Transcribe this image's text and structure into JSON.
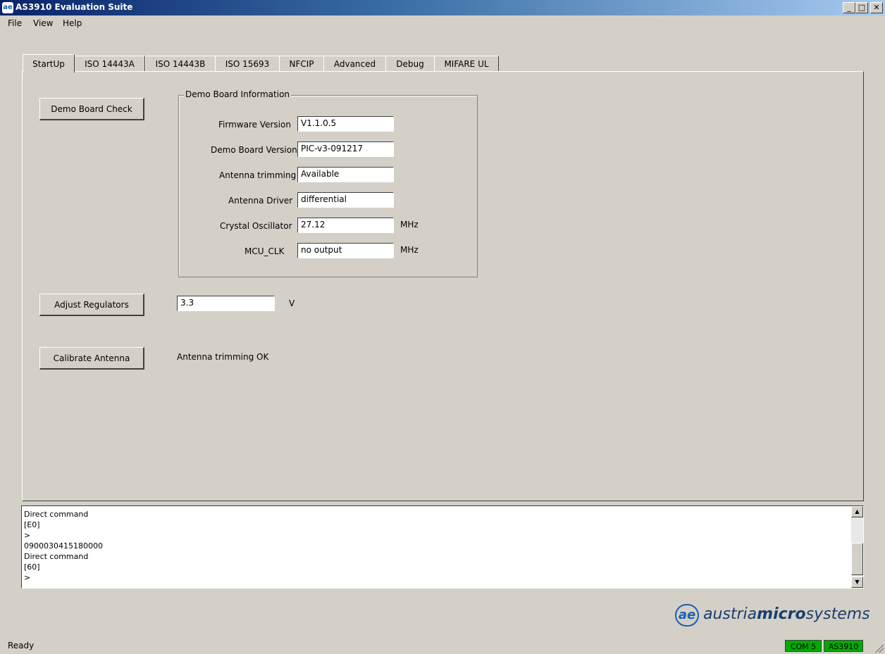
{
  "window": {
    "title": "AS3910 Evaluation Suite",
    "icon": "app-logo-icon"
  },
  "menu": [
    "File",
    "View",
    "Help"
  ],
  "tabs": [
    "StartUp",
    "ISO 14443A",
    "ISO 14443B",
    "ISO 15693",
    "NFCIP",
    "Advanced",
    "Debug",
    "MIFARE UL"
  ],
  "active_tab": "StartUp",
  "startup": {
    "demo_board_check_button": "Demo Board Check",
    "info_group_title": "Demo Board Information",
    "fields": [
      {
        "label": "Firmware Version",
        "value": "V1.1.0.5",
        "unit": ""
      },
      {
        "label": "Demo Board Version",
        "value": "PIC-v3-091217",
        "unit": ""
      },
      {
        "label": "Antenna trimming",
        "value": "Available",
        "unit": ""
      },
      {
        "label": "Antenna Driver",
        "value": "differential",
        "unit": ""
      },
      {
        "label": "Crystal Oscillator",
        "value": "27.12",
        "unit": "MHz"
      },
      {
        "label": "MCU_CLK",
        "value": "no output",
        "unit": "MHz"
      }
    ],
    "adjust_regulators_button": "Adjust Regulators",
    "regulator_value": "3.3",
    "regulator_unit": "V",
    "calibrate_antenna_button": "Calibrate Antenna",
    "calibration_status": "Antenna trimming OK"
  },
  "console": {
    "lines": [
      "Direct command",
      "[E0]",
      ">",
      "0900030415180000",
      "Direct command",
      "[60]",
      ">"
    ]
  },
  "logo": {
    "prefix": "austria",
    "middle": "micro",
    "suffix": "systems"
  },
  "status": {
    "text": "Ready",
    "port": "COM 5",
    "device": "AS3910",
    "indicator_color": "#00aa00"
  }
}
